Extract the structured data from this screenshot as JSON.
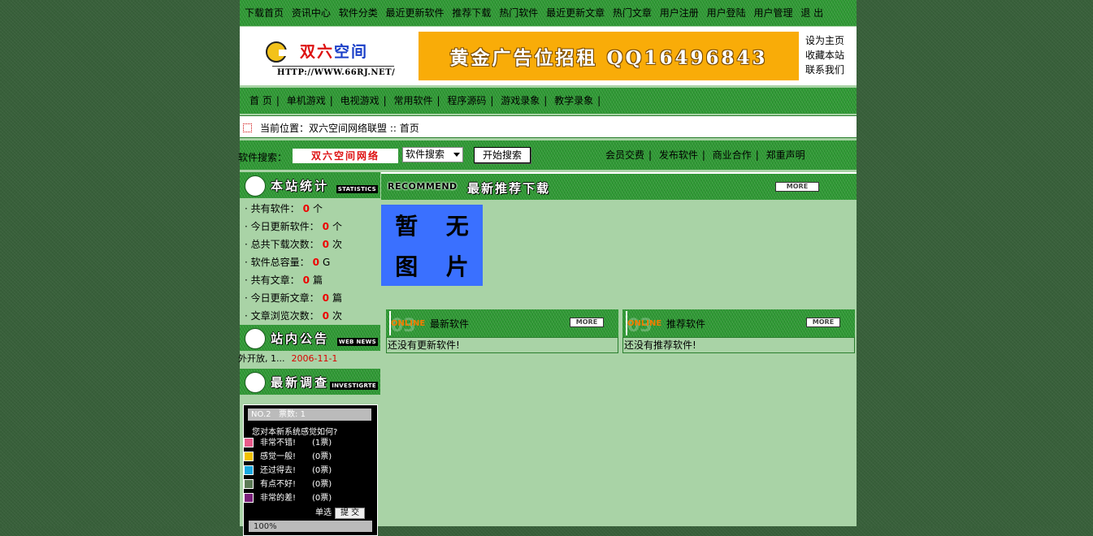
{
  "top_nav": [
    "下载首页",
    "资讯中心",
    "软件分类",
    "最近更新软件",
    "推荐下载",
    "热门软件",
    "最近更新文章",
    "热门文章",
    "用户注册",
    "用户登陆",
    "用户管理",
    "退 出"
  ],
  "logo": {
    "name_part1": "双六",
    "name_part2": "空间",
    "url": "HTTP://WWW.66RJ.NET/"
  },
  "ad_banner": "黄金广告位招租 QQ16496843",
  "header_links": [
    "设为主页",
    "收藏本站",
    "联系我们"
  ],
  "main_nav": [
    "首 页",
    "单机游戏",
    "电视游戏",
    "常用软件",
    "程序源码",
    "游戏录象",
    "教学录象"
  ],
  "breadcrumb": "当前位置：双六空间网络联盟 :: 首页",
  "search": {
    "label": "软件搜索：",
    "logo_text": "双六空间网络",
    "select_value": "软件搜索",
    "button": "开始搜索"
  },
  "utility_links": [
    "会员交费",
    "发布软件",
    "商业合作",
    "郑重声明"
  ],
  "stats_box": {
    "title": "本站统计",
    "subtitle": "STATISTICS",
    "rows": [
      {
        "label": "共有软件：",
        "value": "0",
        "unit": "个"
      },
      {
        "label": "今日更新软件：",
        "value": "0",
        "unit": "个"
      },
      {
        "label": "总共下载次数：",
        "value": "0",
        "unit": "次"
      },
      {
        "label": "软件总容量：",
        "value": "0",
        "unit": "G"
      },
      {
        "label": "共有文章：",
        "value": "0",
        "unit": "篇"
      },
      {
        "label": "今日更新文章：",
        "value": "0",
        "unit": "篇"
      },
      {
        "label": "文章浏览次数：",
        "value": "0",
        "unit": "次"
      }
    ]
  },
  "notice_box": {
    "title": "站内公告",
    "subtitle": "WEB NEWS",
    "text": "外开放, 1...",
    "date": "2006-11-1"
  },
  "poll_box": {
    "title": "最新调查",
    "subtitle": "INVESTIGRTE",
    "number": "NO.2",
    "votes": "票数: 1",
    "question": "您对本新系统感觉如何?",
    "options": [
      {
        "label": "非常不错!",
        "count": "(1票)",
        "color": "#e85b8a"
      },
      {
        "label": "感觉一般!",
        "count": "(0票)",
        "color": "#f2c100"
      },
      {
        "label": "还过得去!",
        "count": "(0票)",
        "color": "#19a8e0"
      },
      {
        "label": "有点不好!",
        "count": "(0票)",
        "color": "#5b7a55"
      },
      {
        "label": "非常的差!",
        "count": "(0票)",
        "color": "#7a1f7a"
      }
    ],
    "mode": "单选",
    "submit": "提 交",
    "percent": "100%"
  },
  "recommend": {
    "en": "RECOMMEND",
    "title": "最新推荐下载",
    "more": "MORE"
  },
  "no_image": [
    "暂",
    "无",
    "图",
    "片"
  ],
  "panels": [
    {
      "watermark": "03",
      "online": "ONLINE",
      "title": "最新软件",
      "more": "MORE",
      "empty": "还没有更新软件!"
    },
    {
      "watermark": "03",
      "online": "ONLINE",
      "title": "推荐软件",
      "more": "MORE",
      "empty": "还没有推荐软件!"
    }
  ]
}
